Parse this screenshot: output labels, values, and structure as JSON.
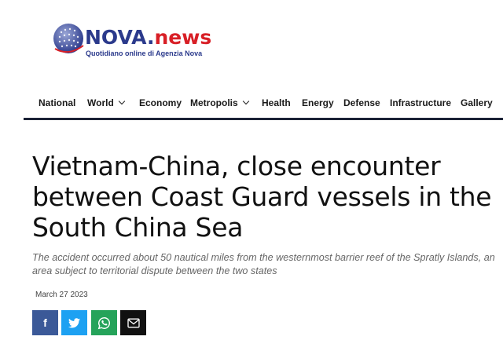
{
  "logo": {
    "name_part1": "NOVA",
    "name_dot": ".",
    "name_part2": "news",
    "tagline": "Quotidiano online di Agenzia Nova",
    "icon": "globe-icon",
    "colors": {
      "primary": "#2b3a8c",
      "accent": "#d81f26"
    }
  },
  "nav": {
    "items": [
      {
        "label": "National"
      },
      {
        "label": "World",
        "has_dropdown": true
      },
      {
        "label": "Economy"
      },
      {
        "label": "Metropolis",
        "has_dropdown": true
      },
      {
        "label": "Health"
      },
      {
        "label": "Energy"
      },
      {
        "label": "Defense"
      },
      {
        "label": "Infrastructure"
      },
      {
        "label": "Gallery"
      }
    ],
    "rule_color": "#1b2236"
  },
  "article": {
    "title": "Vietnam-China, close encounter between Coast Guard vessels in the South China Sea",
    "lead": "The accident occurred about 50 nautical miles from the westernmost barrier reef of the Spratly Islands, an area subject to territorial dispute between the two states",
    "date": "March 27 2023"
  },
  "share": {
    "buttons": [
      {
        "name": "facebook",
        "icon": "facebook-icon",
        "glyph": "f",
        "color": "#3b5998"
      },
      {
        "name": "twitter",
        "icon": "twitter-icon",
        "glyph": "",
        "color": "#1da1f2"
      },
      {
        "name": "whatsapp",
        "icon": "whatsapp-icon",
        "glyph": "",
        "color": "#25a35a"
      },
      {
        "name": "email",
        "icon": "email-icon",
        "glyph": "",
        "color": "#111111"
      }
    ]
  }
}
